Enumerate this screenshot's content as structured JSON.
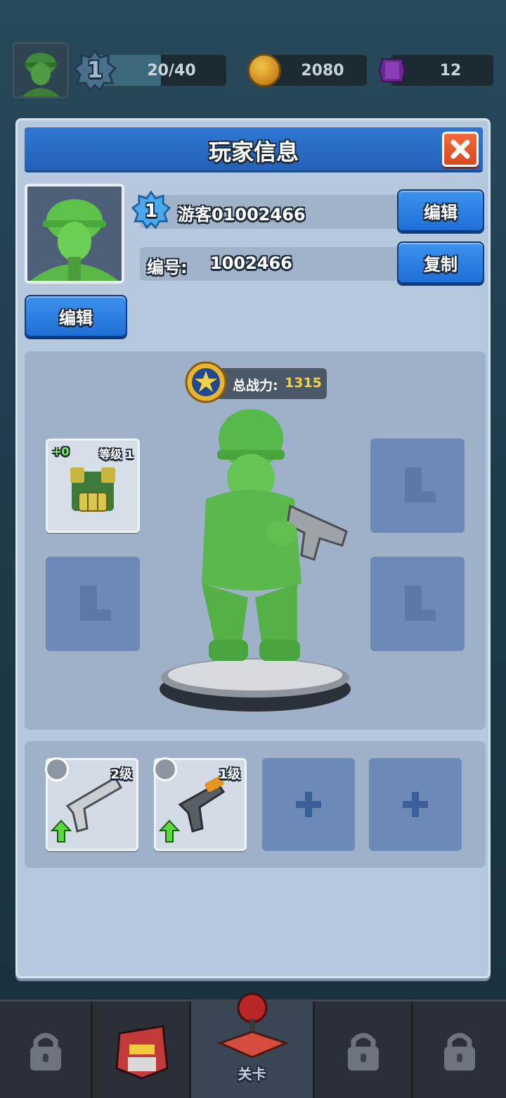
{
  "topbar": {
    "level": "1",
    "xp_text": "20/40",
    "xp_progress": 0.5,
    "coins": "2080",
    "gems": "12"
  },
  "panel": {
    "title": "玩家信息",
    "player_level": "1",
    "player_name": "游客01002466",
    "id_label": "编号:",
    "id_value": "1002466",
    "edit_name_label": "编辑",
    "copy_label": "复制",
    "edit_avatar_label": "编辑",
    "power_label": "总战力:",
    "power_value": "1315",
    "armor_slot": {
      "bonus": "+0",
      "level_text": "等级 1"
    },
    "weapons": [
      {
        "level_text": "2级",
        "type": "pistol"
      },
      {
        "level_text": "1级",
        "type": "smg"
      }
    ],
    "empty_weapon_slots": 2
  },
  "nav": {
    "active_label": "关卡",
    "items": [
      "lock",
      "robot-head",
      "stage",
      "lock",
      "lock"
    ]
  },
  "colors": {
    "accent_blue": "#2462b9",
    "close_red": "#e0532a",
    "power_yellow": "#f5d53b",
    "panel_bg": "#b6c8dd"
  }
}
